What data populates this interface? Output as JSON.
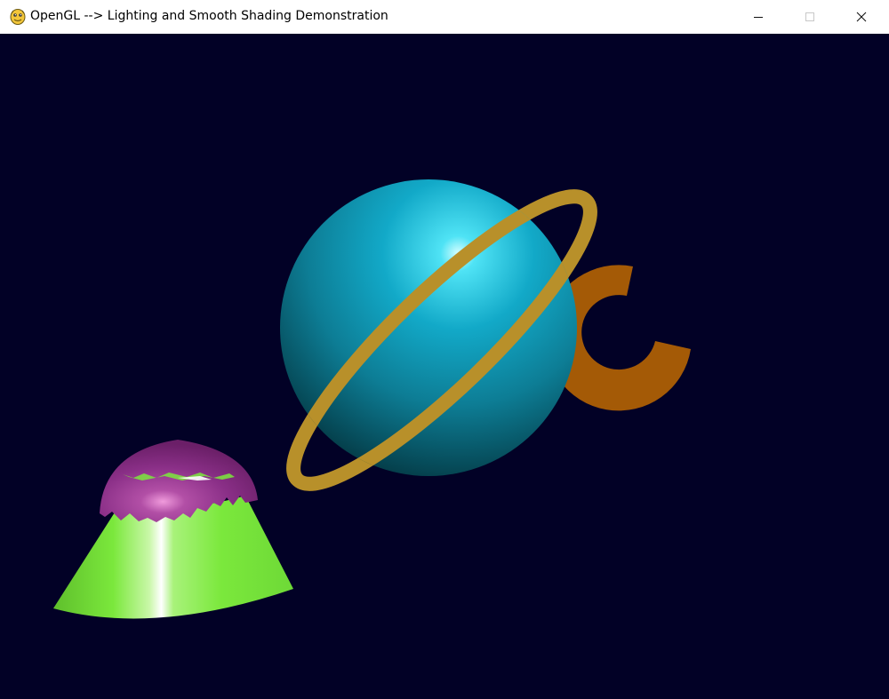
{
  "window": {
    "title": "OpenGL --> Lighting and Smooth Shading Demonstration",
    "app_icon": "python-snake-icon",
    "controls": [
      "minimize-icon",
      "maximize-icon",
      "close-icon"
    ]
  },
  "scene": {
    "background_color": "#020126",
    "objects": [
      {
        "name": "sphere",
        "color": "#12a9c8"
      },
      {
        "name": "torus-ring",
        "color": "#b8902a"
      },
      {
        "name": "partial-torus",
        "color": "#a45a06"
      },
      {
        "name": "capped-cone",
        "cone_color": "#7be83c",
        "cap_color": "#8a2f87"
      }
    ]
  }
}
